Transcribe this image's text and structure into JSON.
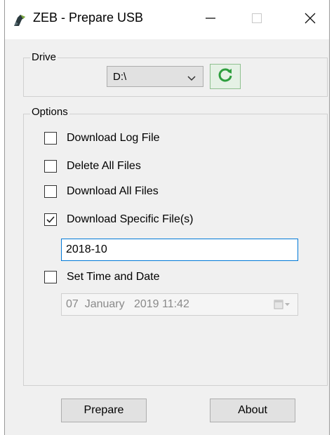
{
  "window": {
    "title": "ZEB - Prepare USB",
    "controls": {
      "minimize": "minimize-icon",
      "maximize": "maximize-icon",
      "close": "close-icon"
    }
  },
  "drive": {
    "label": "Drive",
    "selected": "D:\\",
    "refresh_icon": "refresh-icon"
  },
  "options": {
    "label": "Options",
    "download_log": {
      "label": "Download Log File",
      "checked": false
    },
    "delete_all": {
      "label": "Delete All Files",
      "checked": false
    },
    "download_all": {
      "label": "Download All Files",
      "checked": false
    },
    "download_specific": {
      "label": "Download Specific File(s)",
      "checked": true,
      "value": "2018-10"
    },
    "set_time": {
      "label": "Set Time and Date",
      "checked": false,
      "value": "07  January   2019 11:42"
    }
  },
  "buttons": {
    "prepare": "Prepare",
    "about": "About"
  },
  "colors": {
    "window_bg": "#f0f0f0",
    "accent_border": "#0078d7",
    "refresh_green": "#2e9e3e"
  }
}
